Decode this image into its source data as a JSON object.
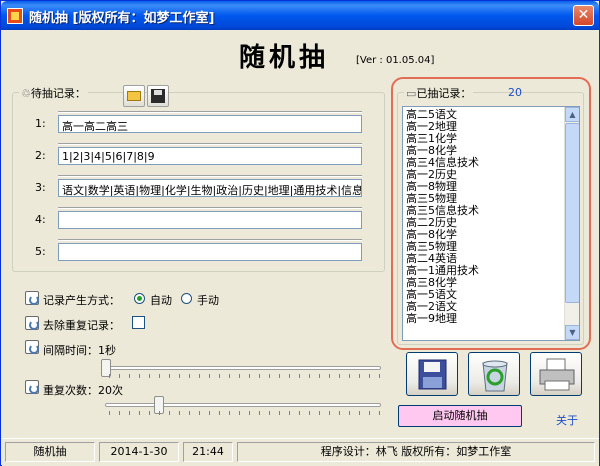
{
  "window": {
    "title": "随机抽   [版权所有：如梦工作室]",
    "close_glyph": "✕"
  },
  "header": {
    "title": "随机抽",
    "version": "[Ver : 01.05.04]"
  },
  "pending": {
    "legend": "待抽记录：",
    "records": [
      {
        "label": "1:",
        "value": "高一高二高三"
      },
      {
        "label": "2:",
        "value": "1|2|3|4|5|6|7|8|9"
      },
      {
        "label": "3:",
        "value": "语文|数学|英语|物理|化学|生物|政治|历史|地理|通用技术|信息"
      },
      {
        "label": "4:",
        "value": ""
      },
      {
        "label": "5:",
        "value": ""
      }
    ]
  },
  "options": {
    "mode_label": "记录产生方式：",
    "auto_label": "自动",
    "manual_label": "手动",
    "mode": "auto",
    "dedupe_label": "去除重复记录：",
    "dedupe_checked": false,
    "interval_label": "间隔时间：1秒",
    "interval_level": 0.0,
    "repeat_label": "重复次数：20次",
    "repeat_level": 0.2
  },
  "drawn": {
    "legend": "已抽记录：",
    "count": "20",
    "items": [
      "高二5语文",
      "高一2地理",
      "高三1化学",
      "高一8化学",
      "高三4信息技术",
      "高一2历史",
      "高一8物理",
      "高三5物理",
      "高三5信息技术",
      "高二2历史",
      "高一8化学",
      "高三5物理",
      "高二4英语",
      "高一1通用技术",
      "高三8化学",
      "高一5语文",
      "高一2语文",
      "高一9地理"
    ]
  },
  "buttons": {
    "start_label": "启动随机抽",
    "about_label": "关于"
  },
  "status": {
    "app": "随机抽",
    "date": "2014-1-30",
    "time": "21:44",
    "credits": "程序设计：林飞  版权所有：如梦工作室"
  },
  "icons": [
    "save-icon",
    "recycle-icon",
    "printer-icon",
    "open-folder-icon",
    "floppy-icon"
  ]
}
